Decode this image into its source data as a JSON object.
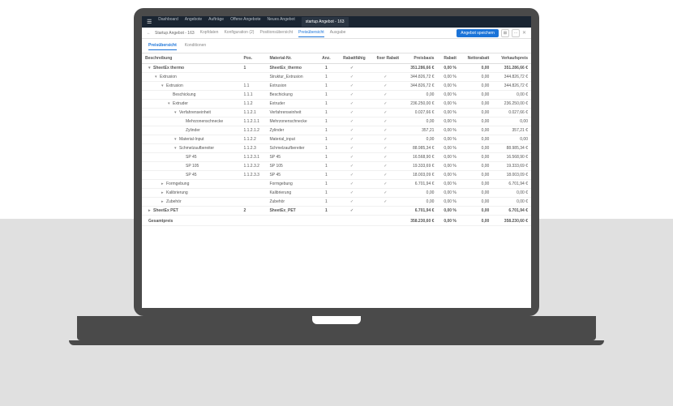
{
  "topnav": [
    "Dashboard",
    "Angebote",
    "Aufträge",
    "Offene Angebote",
    "Neues Angebot",
    "startup Angebot - 163"
  ],
  "subnav": {
    "crumb": "Startup Angebot - 163",
    "tabs": [
      "Kopfdaten",
      "Konfiguration (2)",
      "Positionsübersicht",
      "Preisübersicht",
      "Ausgabe"
    ],
    "active": 3,
    "save": "Angebot speichern"
  },
  "maintabs": {
    "items": [
      "Preisübersicht",
      "Konditionen"
    ],
    "active": 0
  },
  "columns": [
    "Beschreibung",
    "Pos.",
    "Material-Nr.",
    "Anz.",
    "Rabattfähig",
    "fixer Rabatt",
    "Preisbasis",
    "Rabatt",
    "Nettorabatt",
    "Verkaufspreis"
  ],
  "rows": [
    {
      "lvl": 0,
      "ex": "▾",
      "desc": "SheetEx thermo",
      "pos": "1",
      "mat": "SheetEx_thermo",
      "anz": "1",
      "rf": true,
      "fr": false,
      "basis": "351.286,66 €",
      "rab": "0,00 %",
      "net": "0,00",
      "vp": "351.286,66 €",
      "bold": true
    },
    {
      "lvl": 1,
      "ex": "▾",
      "desc": "Extrusion",
      "pos": "",
      "mat": "Struktur_Extrusion",
      "anz": "1",
      "rf": true,
      "fr": true,
      "basis": "344.826,72 €",
      "rab": "0,00 %",
      "net": "0,00",
      "vp": "344.826,72 €"
    },
    {
      "lvl": 2,
      "ex": "▾",
      "desc": "Extrusion",
      "pos": "1.1",
      "mat": "Extrusion",
      "anz": "1",
      "rf": true,
      "fr": true,
      "basis": "344.826,72 €",
      "rab": "0,00 %",
      "net": "0,00",
      "vp": "344.826,72 €"
    },
    {
      "lvl": 3,
      "ex": "",
      "desc": "Beschickung",
      "pos": "1.1.1",
      "mat": "Beschickung",
      "anz": "1",
      "rf": true,
      "fr": true,
      "basis": "0,00",
      "rab": "0,00 %",
      "net": "0,00",
      "vp": "0,00 €"
    },
    {
      "lvl": 3,
      "ex": "▾",
      "desc": "Extruder",
      "pos": "1.1.2",
      "mat": "Extruder",
      "anz": "1",
      "rf": true,
      "fr": true,
      "basis": "236.250,00 €",
      "rab": "0,00 %",
      "net": "0,00",
      "vp": "236.250,00 €"
    },
    {
      "lvl": 4,
      "ex": "▾",
      "desc": "Verfahrenseinheit",
      "pos": "1.1.2.1",
      "mat": "Verfahrenseinheit",
      "anz": "1",
      "rf": true,
      "fr": true,
      "basis": "0.027,66 €",
      "rab": "0,00 %",
      "net": "0,00",
      "vp": "0.027,66 €"
    },
    {
      "lvl": 5,
      "ex": "",
      "desc": "Mehrzonenschnecke",
      "pos": "1.1.2.1.1",
      "mat": "Mehrzonenschnecke",
      "anz": "1",
      "rf": true,
      "fr": true,
      "basis": "0,00",
      "rab": "0,00 %",
      "net": "0,00",
      "vp": "0,00"
    },
    {
      "lvl": 5,
      "ex": "",
      "desc": "Zylinder",
      "pos": "1.1.2.1.2",
      "mat": "Zylinder",
      "anz": "1",
      "rf": true,
      "fr": true,
      "basis": "357,21",
      "rab": "0,00 %",
      "net": "0,00",
      "vp": "357,21 €"
    },
    {
      "lvl": 4,
      "ex": "▾",
      "desc": "Material-Input",
      "pos": "1.1.2.2",
      "mat": "Material_input",
      "anz": "1",
      "rf": true,
      "fr": true,
      "basis": "0,00",
      "rab": "0,00 %",
      "net": "0,00",
      "vp": "0,00"
    },
    {
      "lvl": 4,
      "ex": "▾",
      "desc": "Schmelzaufbereiter",
      "pos": "1.1.2.3",
      "mat": "Schmelzaufbereiter",
      "anz": "1",
      "rf": true,
      "fr": true,
      "basis": "88.985,34 €",
      "rab": "0,00 %",
      "net": "0,00",
      "vp": "88.985,34 €"
    },
    {
      "lvl": 5,
      "ex": "",
      "desc": "SP 45",
      "pos": "1.1.2.3.1",
      "mat": "SP 45",
      "anz": "1",
      "rf": true,
      "fr": true,
      "basis": "16.568,90 €",
      "rab": "0,00 %",
      "net": "0,00",
      "vp": "16.568,90 €"
    },
    {
      "lvl": 5,
      "ex": "",
      "desc": "SP 105",
      "pos": "1.1.2.3.2",
      "mat": "SP 105",
      "anz": "1",
      "rf": true,
      "fr": true,
      "basis": "19.333,69 €",
      "rab": "0,00 %",
      "net": "0,00",
      "vp": "19.333,69 €"
    },
    {
      "lvl": 5,
      "ex": "",
      "desc": "SP 45",
      "pos": "1.1.2.3.3",
      "mat": "SP 45",
      "anz": "1",
      "rf": true,
      "fr": true,
      "basis": "18.003,09 €",
      "rab": "0,00 %",
      "net": "0,00",
      "vp": "18.003,09 €"
    },
    {
      "lvl": 2,
      "ex": "▸",
      "desc": "Formgebung",
      "pos": "",
      "mat": "Formgebung",
      "anz": "1",
      "rf": true,
      "fr": true,
      "basis": "6.701,94 €",
      "rab": "0,00 %",
      "net": "0,00",
      "vp": "6.701,94 €"
    },
    {
      "lvl": 2,
      "ex": "▸",
      "desc": "Kalibrierung",
      "pos": "",
      "mat": "Kalibrierung",
      "anz": "1",
      "rf": true,
      "fr": true,
      "basis": "0,00",
      "rab": "0,00 %",
      "net": "0,00",
      "vp": "0,00 €"
    },
    {
      "lvl": 2,
      "ex": "▸",
      "desc": "Zubehör",
      "pos": "",
      "mat": "Zubehör",
      "anz": "1",
      "rf": true,
      "fr": true,
      "basis": "0,00",
      "rab": "0,00 %",
      "net": "0,00",
      "vp": "0,00 €"
    },
    {
      "lvl": 0,
      "ex": "▸",
      "desc": "SheetEx PET",
      "pos": "2",
      "mat": "SheetEx_PET",
      "anz": "1",
      "rf": true,
      "fr": false,
      "basis": "6.701,94 €",
      "rab": "0,00 %",
      "net": "0,00",
      "vp": "6.701,94 €",
      "bold": true
    }
  ],
  "total": {
    "label": "Gesamtpreis",
    "basis": "358.230,60 €",
    "rab": "0,00 %",
    "net": "0,00",
    "vp": "358.230,60 €"
  }
}
